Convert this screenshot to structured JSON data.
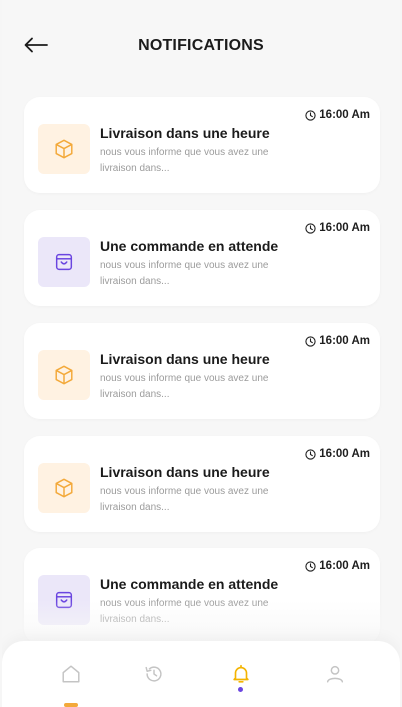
{
  "header": {
    "title": "NOTIFICATIONS"
  },
  "colors": {
    "delivery_icon": "#f3a93a",
    "delivery_bg": "#fff2e2",
    "order_icon": "#6a45e0",
    "order_bg": "#ebe7f9",
    "active_nav": "#f4b400"
  },
  "notifications": [
    {
      "type": "delivery",
      "icon": "box-icon",
      "time": "16:00 Am",
      "title": "Livraison dans une heure",
      "line1": "nous vous informe que vous avez une",
      "line2": "livraison dans..."
    },
    {
      "type": "order",
      "icon": "shopping-bag-icon",
      "time": "16:00 Am",
      "title": "Une commande en attende",
      "line1": "nous vous informe que vous avez une",
      "line2": "livraison dans..."
    },
    {
      "type": "delivery",
      "icon": "box-icon",
      "time": "16:00 Am",
      "title": "Livraison dans une heure",
      "line1": "nous vous informe que vous avez une",
      "line2": "livraison dans..."
    },
    {
      "type": "delivery",
      "icon": "box-icon",
      "time": "16:00 Am",
      "title": "Livraison dans une heure",
      "line1": "nous vous informe que vous avez une",
      "line2": "livraison dans..."
    },
    {
      "type": "order",
      "icon": "shopping-bag-icon",
      "time": "16:00 Am",
      "title": "Une commande en attende",
      "line1": "nous vous informe que vous avez une",
      "line2": "livraison dans..."
    }
  ],
  "nav": {
    "items": [
      {
        "icon": "home-icon",
        "active": false
      },
      {
        "icon": "history-icon",
        "active": false
      },
      {
        "icon": "bell-icon",
        "active": true
      },
      {
        "icon": "user-icon",
        "active": false
      }
    ]
  }
}
